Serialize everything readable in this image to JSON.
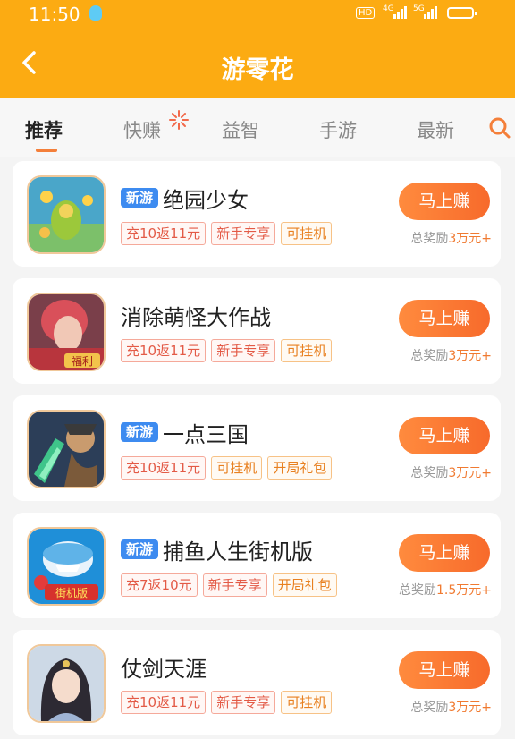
{
  "status_bar": {
    "time": "11:50",
    "hd_label": "HD",
    "net1": "4G",
    "net2": "5G"
  },
  "header": {
    "title": "游零花"
  },
  "tabs": [
    {
      "label": "推荐",
      "active": true
    },
    {
      "label": "快赚"
    },
    {
      "label": "益智"
    },
    {
      "label": "手游"
    },
    {
      "label": "最新"
    }
  ],
  "games": [
    {
      "name": "绝园少女",
      "new_badge": "新游",
      "tags": [
        {
          "text": "充10返11元",
          "style": "red"
        },
        {
          "text": "新手专享",
          "style": "red"
        },
        {
          "text": "可挂机",
          "style": "orange"
        }
      ],
      "button": "马上赚",
      "reward_prefix": "总奖励",
      "reward_amount": "3万元+"
    },
    {
      "name": "消除萌怪大作战",
      "new_badge": "",
      "tags": [
        {
          "text": "充10返11元",
          "style": "red"
        },
        {
          "text": "新手专享",
          "style": "red"
        },
        {
          "text": "可挂机",
          "style": "orange"
        }
      ],
      "button": "马上赚",
      "reward_prefix": "总奖励",
      "reward_amount": "3万元+",
      "icon_label": "福利"
    },
    {
      "name": "一点三国",
      "new_badge": "新游",
      "tags": [
        {
          "text": "充10返11元",
          "style": "red"
        },
        {
          "text": "可挂机",
          "style": "orange"
        },
        {
          "text": "开局礼包",
          "style": "orange"
        }
      ],
      "button": "马上赚",
      "reward_prefix": "总奖励",
      "reward_amount": "3万元+"
    },
    {
      "name": "捕鱼人生街机版",
      "new_badge": "新游",
      "tags": [
        {
          "text": "充7返10元",
          "style": "red"
        },
        {
          "text": "新手专享",
          "style": "red"
        },
        {
          "text": "开局礼包",
          "style": "orange"
        }
      ],
      "button": "马上赚",
      "reward_prefix": "总奖励",
      "reward_amount": "1.5万元+",
      "icon_label": "街机版"
    },
    {
      "name": "仗剑天涯",
      "new_badge": "",
      "tags": [
        {
          "text": "充10返11元",
          "style": "red"
        },
        {
          "text": "新手专享",
          "style": "red"
        },
        {
          "text": "可挂机",
          "style": "orange"
        }
      ],
      "button": "马上赚",
      "reward_prefix": "总奖励",
      "reward_amount": "3万元+"
    }
  ]
}
